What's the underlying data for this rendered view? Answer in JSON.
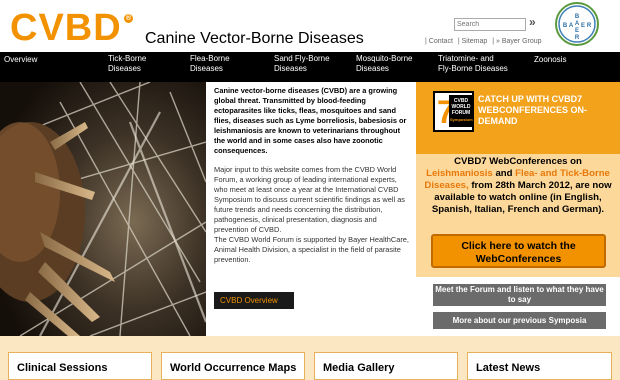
{
  "header": {
    "logo_text": "CVBD",
    "registered": "®",
    "site_title": "Canine Vector-Borne Diseases",
    "search_placeholder": "Search",
    "search_arrow": "»",
    "links": [
      "| Contact",
      "| Sitemap",
      "| » Bayer Group"
    ],
    "bayer_logo_text": "BAYER"
  },
  "nav": {
    "items": [
      {
        "label": "Overview"
      },
      {
        "label": "Tick-Borne Diseases"
      },
      {
        "label": "Flea-Borne Diseases"
      },
      {
        "label": "Sand Fly-Borne Diseases"
      },
      {
        "label": "Mosquito-Borne Diseases"
      },
      {
        "label": "Triatomine- and Fly-Borne Diseases"
      },
      {
        "label": "Zoonosis"
      }
    ]
  },
  "intro": {
    "bold": "Canine vector-borne diseases (CVBD) are a growing global threat. Transmitted by blood-feeding ectoparasites like ticks, fleas, mosquitoes and sand flies, diseases such as Lyme borreliosis, babesiosis or leishmaniosis are known to veterinarians throughout the world and in some cases also have zoonotic consequences.",
    "body1": "Major input to this website comes from the CVBD World Forum, a working group of leading international experts, who meet at least once a year at the International CVBD Symposium to discuss current scientific findings as well as future trends and needs concerning the distribution, pathogenesis, clinical presentation, diagnosis and prevention of CVBD.",
    "body2": "The CVBD World Forum is supported by Bayer HealthCare, Animal Health Division, a specialist in the field of parasite prevention.",
    "button": "CVBD Overview"
  },
  "promo": {
    "badge_number": "7",
    "badge_line1": "CVBD",
    "badge_line2": "WORLD FORUM",
    "badge_line3": "Symposium",
    "catch_up": "CATCH UP WITH CVBD7 WEBCONFERENCES ON-DEMAND",
    "text_before": "CVBD7 WebConferences on",
    "hl1": "Leishmaniosis",
    "text_and": "and",
    "hl2": "Flea- and Tick-Borne Diseases,",
    "text_after": "from 28th March 2012, are now available to watch online (in English, Spanish, Italian, French and German).",
    "watch_button": "Click here to watch the WebConferences",
    "meet_button": "Meet the Forum and listen to what they have to say",
    "symposia_button": "More about our previous Symposia"
  },
  "bottom": {
    "boxes": [
      "Clinical Sessions",
      "World Occurrence Maps",
      "Media Gallery",
      "Latest News"
    ]
  },
  "colors": {
    "brand_orange": "#f39200",
    "nav_bg": "#000000",
    "bayer_green": "#5b9a3c"
  }
}
